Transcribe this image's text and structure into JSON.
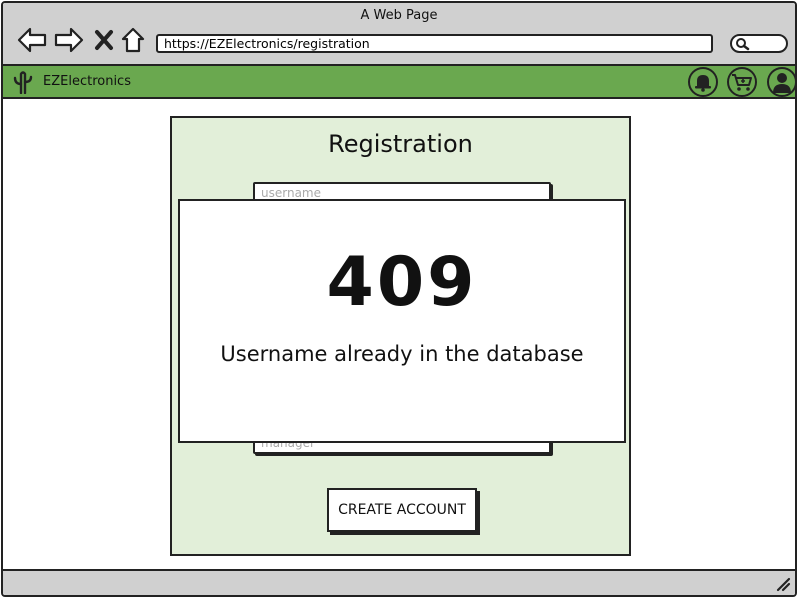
{
  "window": {
    "title": "A Web Page"
  },
  "browser": {
    "url": "https://EZElectronics/registration",
    "icons": [
      "back-arrow-icon",
      "forward-arrow-icon",
      "close-icon",
      "home-icon",
      "search-icon"
    ]
  },
  "app": {
    "name": "EZElectronics",
    "accent_color": "#6aa84f",
    "actions": [
      "bell-icon",
      "cart-icon",
      "user-icon"
    ]
  },
  "registration": {
    "title": "Registration",
    "fields": {
      "username_placeholder": "username",
      "role_placeholder": "manager"
    },
    "submit_label": "CREATE ACCOUNT",
    "panel_color": "#e2efd9"
  },
  "error_dialog": {
    "code": "409",
    "message": "Username already in the database"
  }
}
